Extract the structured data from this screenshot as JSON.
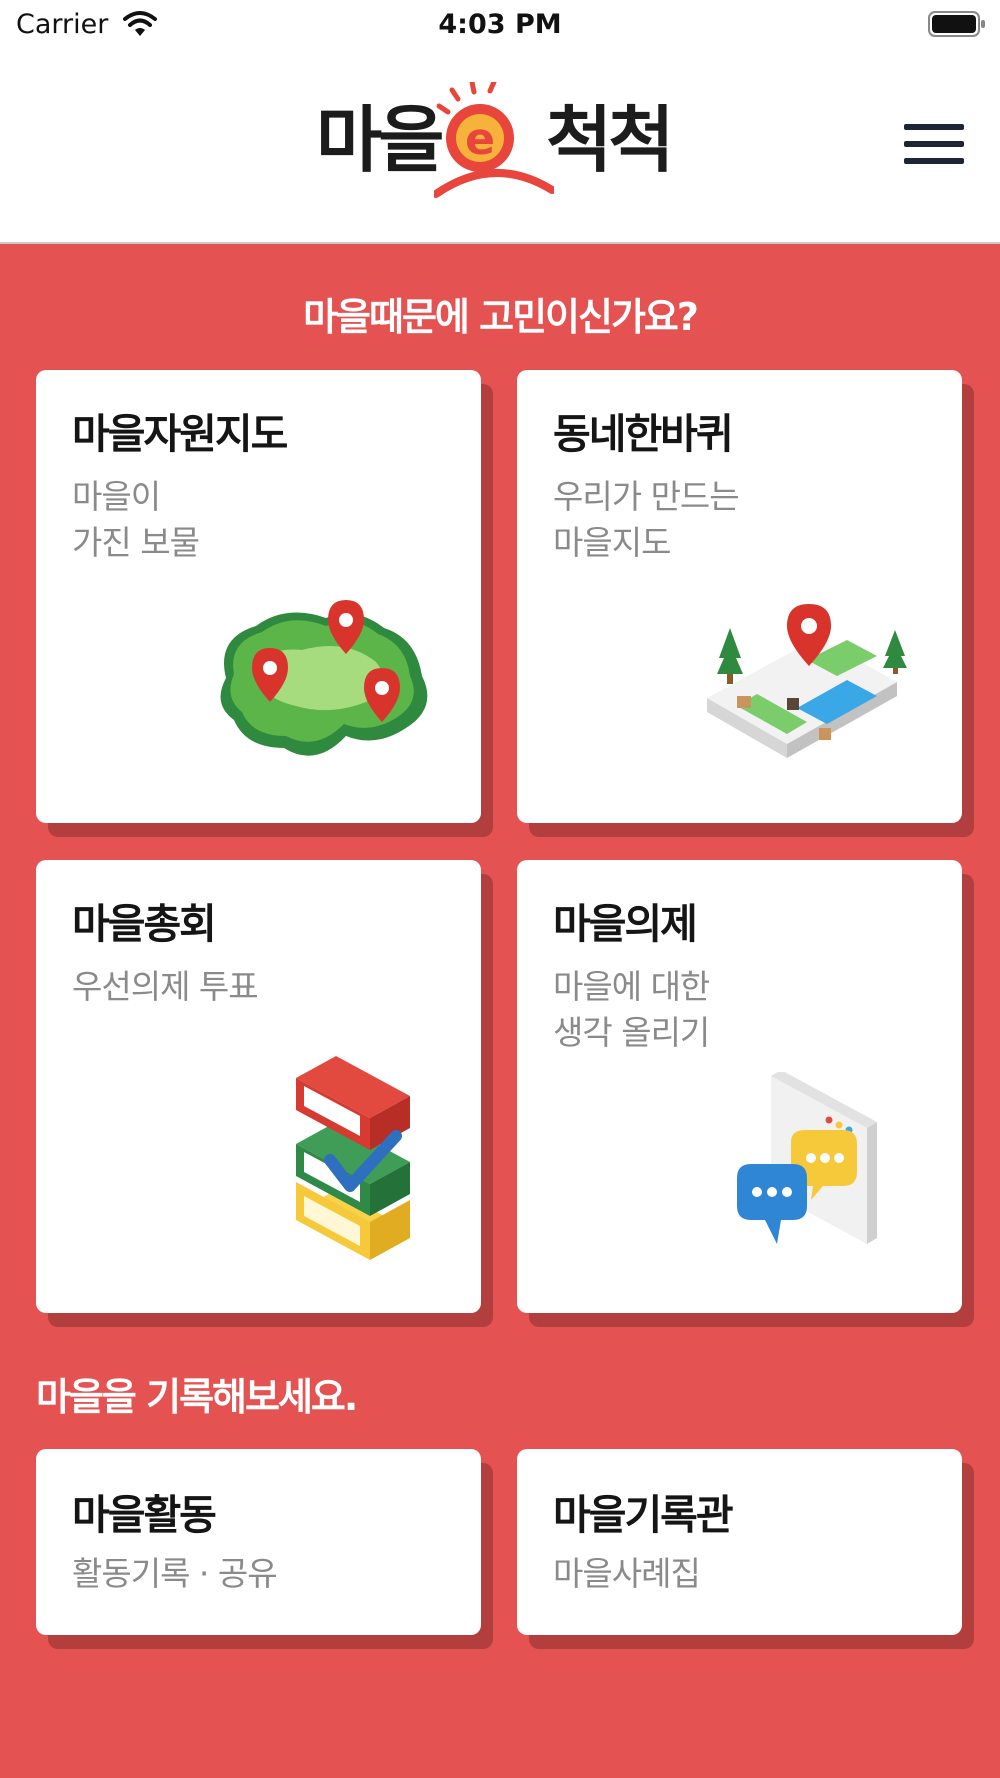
{
  "status_bar": {
    "carrier": "Carrier",
    "time": "4:03 PM"
  },
  "header": {
    "logo_left": "마을",
    "logo_right": "척척",
    "logo_mark_letter": "e",
    "menu_icon": "hamburger-icon"
  },
  "section1": {
    "title": "마을때문에 고민이신가요?"
  },
  "section2": {
    "title": "마을을 기록해보세요."
  },
  "cards": [
    {
      "title": "마을자원지도",
      "desc": "마을이\n가진 보물",
      "icon": "village-map-pins-icon"
    },
    {
      "title": "동네한바퀴",
      "desc": "우리가 만드는\n마을지도",
      "icon": "isometric-map-pin-icon"
    },
    {
      "title": "마을총회",
      "desc": "우선의제 투표",
      "icon": "ballot-boxes-check-icon"
    },
    {
      "title": "마을의제",
      "desc": "마을에 대한\n생각 올리기",
      "icon": "chat-bubbles-icon"
    },
    {
      "title": "마을활동",
      "desc": "활동기록 · 공유"
    },
    {
      "title": "마을기록관",
      "desc": "마을사례집"
    }
  ],
  "colors": {
    "background": "#e45252",
    "card_shadow": "#b33e3e",
    "brand_red": "#e8453c",
    "text_dark": "#151515",
    "text_muted": "#8a8a8a"
  }
}
